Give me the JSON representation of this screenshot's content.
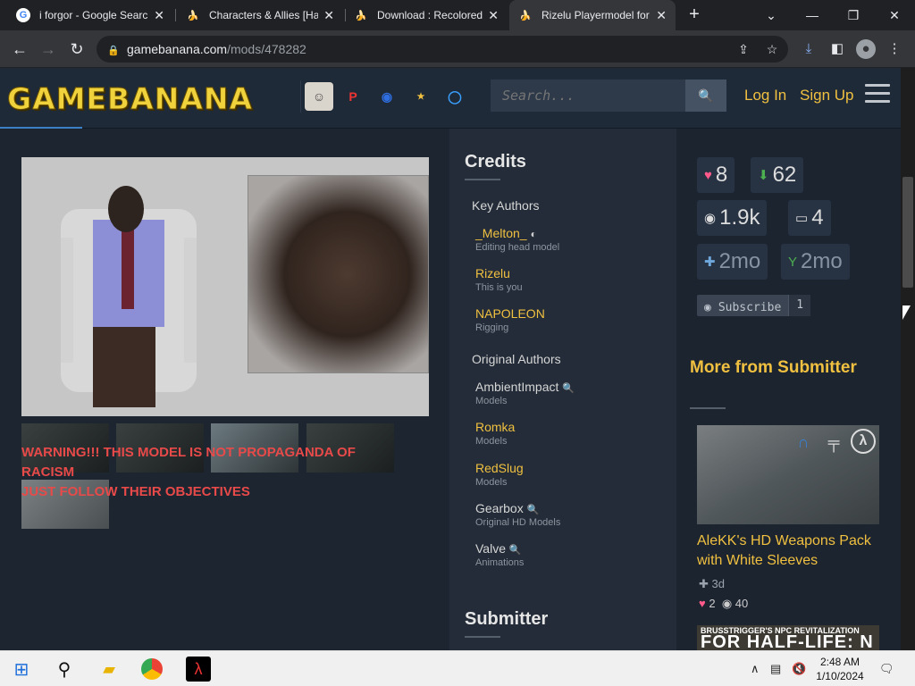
{
  "browser": {
    "tabs": [
      {
        "title": "i forgor - Google Search",
        "favicon": "google"
      },
      {
        "title": "Characters & Allies [Half-Life]",
        "favicon": "banana"
      },
      {
        "title": "Download : Recolored",
        "favicon": "banana"
      },
      {
        "title": "Rizelu Playermodel for",
        "favicon": "banana",
        "active": true
      }
    ],
    "url_host": "gamebanana.com",
    "url_path": "/mods/478282"
  },
  "site": {
    "logo": "GAMEBANANA",
    "search_placeholder": "Search...",
    "login": "Log In",
    "signup": "Sign Up"
  },
  "warning": {
    "line1": "WARNING!!! THIS MODEL IS NOT PROPAGANDA OF RACISM",
    "line2": "JUST FOLLOW THEIR OBJECTIVES"
  },
  "credits": {
    "heading": "Credits",
    "key_authors_label": "Key Authors",
    "key_authors": [
      {
        "name": "_Melton_",
        "role": "Editing head model"
      },
      {
        "name": "Rizelu",
        "role": "This is you"
      },
      {
        "name": "NAPOLEON",
        "role": "Rigging"
      }
    ],
    "original_authors_label": "Original Authors",
    "original_authors": [
      {
        "name": "AmbientImpact",
        "role": "Models"
      },
      {
        "name": "Romka",
        "role": "Models"
      },
      {
        "name": "RedSlug",
        "role": "Models"
      },
      {
        "name": "Gearbox",
        "role": "Original HD Models"
      },
      {
        "name": "Valve",
        "role": "Animations"
      }
    ],
    "submitter_heading": "Submitter"
  },
  "stats": {
    "likes": "8",
    "downloads": "62",
    "views": "1.9k",
    "posts": "4",
    "added": "2mo",
    "updated": "2mo",
    "subscribe_label": "Subscribe",
    "subscribe_count": "1"
  },
  "more": {
    "heading": "More from Submitter",
    "item_title": "AleKK's HD Weapons Pack with White Sleeves",
    "item_age": "3d",
    "item_likes": "2",
    "item_views": "40",
    "item2_banner": "BRUSSTRIGGER'S NPC REVITALIZATION",
    "item2_big": "FOR HALF-LIFE: N"
  },
  "clock": {
    "time": "2:48 AM",
    "date": "1/10/2024"
  },
  "colors": {
    "accent": "#f0c040",
    "warning": "#e84a4a",
    "link_blue": "#3b7fc4"
  }
}
